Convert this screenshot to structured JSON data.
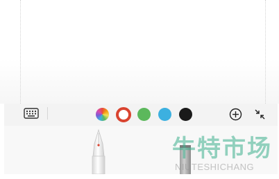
{
  "canvas": {
    "guides": 2
  },
  "toolbar": {
    "keyboard_icon": "keyboard-icon",
    "colors": [
      {
        "name": "multicolor",
        "value": "rainbow",
        "selected": false
      },
      {
        "name": "red",
        "value": "#d9432f",
        "selected": true
      },
      {
        "name": "green",
        "value": "#5cb85c",
        "selected": false
      },
      {
        "name": "blue",
        "value": "#3cb0e0",
        "selected": false
      },
      {
        "name": "black",
        "value": "#1a1a1a",
        "selected": false
      }
    ],
    "add_icon": "plus-circle-icon",
    "collapse_icon": "collapse-arrows-icon"
  },
  "tray": {
    "tools": [
      "fountain-pen-icon",
      "marker-icon"
    ]
  },
  "watermark": {
    "title": "牛特市场",
    "subtitle": "NIUTESHICHANG"
  }
}
